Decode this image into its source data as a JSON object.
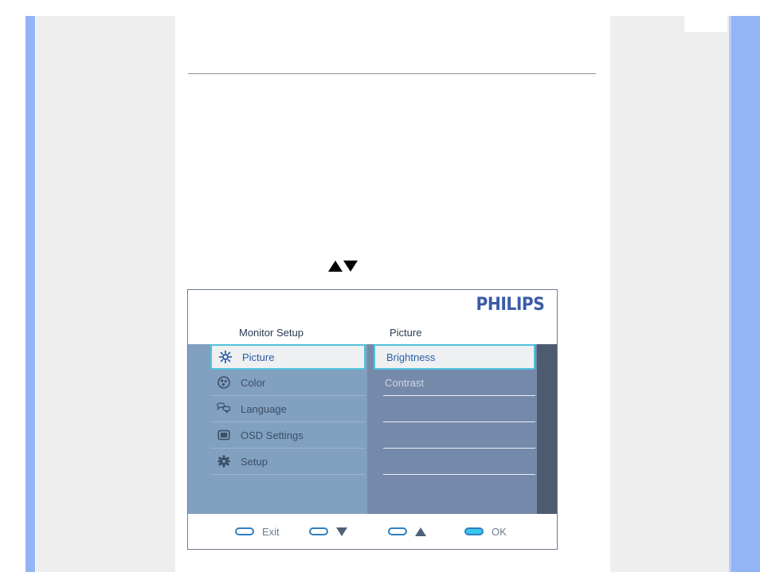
{
  "page": {
    "background_color": "#ffffff",
    "accent_blue": "#93b4f5",
    "panel_gray": "#eeeeee"
  },
  "hint_arrows": {
    "up_icon": "triangle-up-icon",
    "down_icon": "triangle-down-icon"
  },
  "osd": {
    "brand": "PHILIPS",
    "brand_color": "#3b5ba8",
    "tabs": [
      {
        "label": "Monitor Setup"
      },
      {
        "label": "Picture"
      }
    ],
    "menu": [
      {
        "label": "Picture",
        "icon": "brightness-icon",
        "selected": true
      },
      {
        "label": "Color",
        "icon": "color-wheel-icon",
        "selected": false
      },
      {
        "label": "Language",
        "icon": "speech-bubble-icon",
        "selected": false
      },
      {
        "label": "OSD Settings",
        "icon": "monitor-icon",
        "selected": false
      },
      {
        "label": "Setup",
        "icon": "gear-icon",
        "selected": false
      }
    ],
    "submenu": [
      {
        "label": "Brightness",
        "selected": true
      },
      {
        "label": "Contrast",
        "selected": false
      },
      {
        "label": "",
        "selected": false
      },
      {
        "label": "",
        "selected": false
      },
      {
        "label": "",
        "selected": false
      },
      {
        "label": "",
        "selected": false
      }
    ],
    "footer": [
      {
        "label": "Exit",
        "icon": "button-pill-icon",
        "filled": false,
        "glyph": ""
      },
      {
        "label": "",
        "icon": "button-pill-icon",
        "filled": false,
        "glyph": "triangle-down-icon"
      },
      {
        "label": "",
        "icon": "button-pill-icon",
        "filled": false,
        "glyph": "triangle-up-icon"
      },
      {
        "label": "OK",
        "icon": "button-pill-icon",
        "filled": true,
        "glyph": ""
      }
    ],
    "colors": {
      "menu_panel": "#82a0c0",
      "submenu_panel": "#7589aa",
      "edge_strip": "#4d5a70",
      "highlight_border": "#4fc3dd",
      "highlight_fill": "#eef0f1"
    }
  }
}
